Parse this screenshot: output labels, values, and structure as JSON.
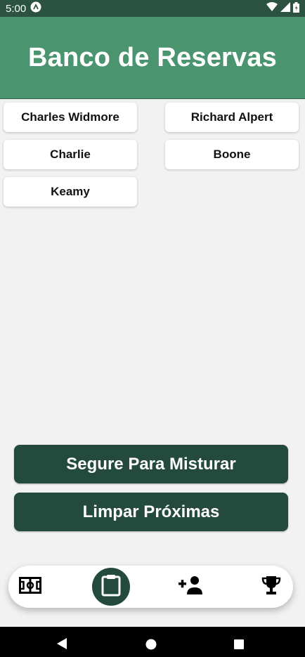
{
  "status_bar": {
    "time": "5:00",
    "icons": [
      "app-notification-icon",
      "wifi-icon",
      "cell-signal-icon",
      "battery-icon"
    ]
  },
  "header": {
    "title": "Banco de Reservas"
  },
  "players": [
    {
      "name": "Charles Widmore"
    },
    {
      "name": "Richard Alpert"
    },
    {
      "name": "Charlie"
    },
    {
      "name": "Boone"
    },
    {
      "name": "Keamy"
    }
  ],
  "actions": {
    "shuffle_label": "Segure Para Misturar",
    "clear_label": "Limpar Próximas"
  },
  "bottom_nav": {
    "items": [
      {
        "icon": "field-icon",
        "active": false
      },
      {
        "icon": "clipboard-icon",
        "active": true
      },
      {
        "icon": "add-person-icon",
        "active": false
      },
      {
        "icon": "trophy-icon",
        "active": false
      }
    ]
  },
  "system_nav": {
    "icons": [
      "back-icon",
      "home-icon",
      "recents-icon"
    ]
  },
  "colors": {
    "header_green": "#4a9470",
    "status_bar": "#2c5242",
    "button_dark_green": "#244a3d",
    "background": "#f2f2f2"
  }
}
